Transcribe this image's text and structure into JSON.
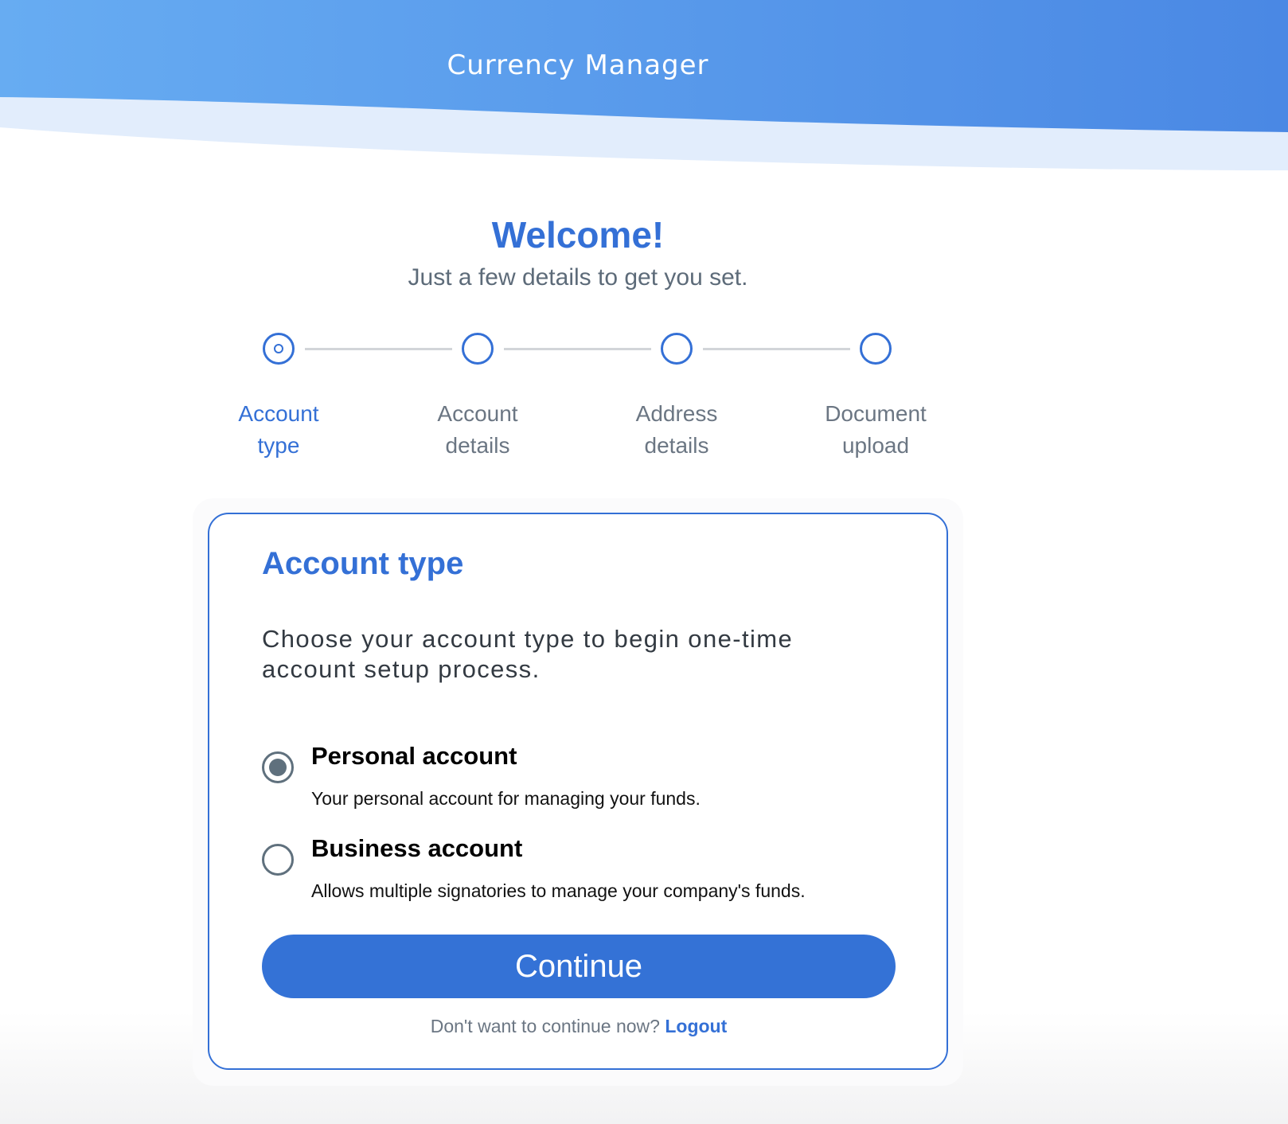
{
  "app": {
    "title": "Currency Manager"
  },
  "welcome": {
    "title": "Welcome!",
    "subtitle": "Just a few details to get you set."
  },
  "stepper": {
    "steps": [
      {
        "line1": "Account",
        "line2": "type"
      },
      {
        "line1": "Account",
        "line2": "details"
      },
      {
        "line1": "Address",
        "line2": "details"
      },
      {
        "line1": "Document",
        "line2": "upload"
      }
    ],
    "active_step": 1
  },
  "card": {
    "title": "Account type",
    "description": "Choose your account type to begin one-time account setup process.",
    "options": [
      {
        "title": "Personal account",
        "description": "Your personal account for managing your funds.",
        "selected": true
      },
      {
        "title": "Business account",
        "description": "Allows multiple signatories to manage your company's funds.",
        "selected": false
      }
    ],
    "continue_label": "Continue",
    "footer_text": "Don't want to continue now?",
    "logout_label": "Logout"
  },
  "colors": {
    "accent": "#3470d6",
    "header_gradient_start": "#67acf2",
    "header_gradient_end": "#4a88e4",
    "wave_light": "#e2edfc"
  },
  "icons": {
    "active_step": "circle-dot-icon",
    "inactive_step": "empty-circle-icon",
    "radio_selected": "radio-selected-icon",
    "radio_unselected": "radio-unselected-icon"
  }
}
